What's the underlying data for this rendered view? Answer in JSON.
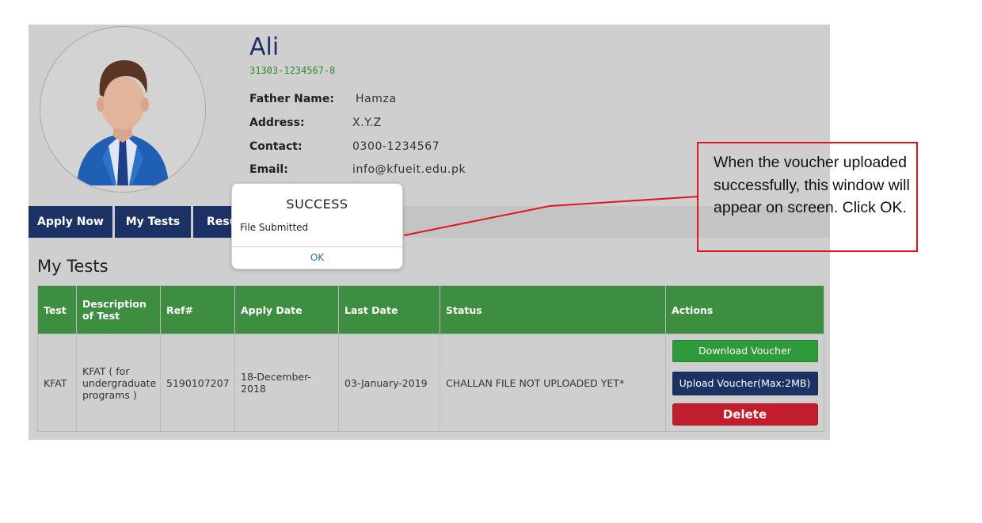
{
  "profile": {
    "name": "Ali",
    "id_number": "31303-1234567-8",
    "fields": [
      {
        "label": "Father Name:",
        "value": "Hamza"
      },
      {
        "label": "Address:",
        "value": "X.Y.Z"
      },
      {
        "label": "Contact:",
        "value": "0300-1234567"
      },
      {
        "label": "Email:",
        "value": "info@kfueit.edu.pk"
      }
    ]
  },
  "nav": {
    "tabs": [
      {
        "label": "Apply Now"
      },
      {
        "label": "My Tests"
      },
      {
        "label": "Resu"
      }
    ]
  },
  "tests": {
    "title": "My Tests",
    "columns": [
      "Test",
      "Description of Test",
      "Ref#",
      "Apply Date",
      "Last Date",
      "Status",
      "Actions"
    ],
    "rows": [
      {
        "test": "KFAT",
        "description": "KFAT ( for undergraduate programs )",
        "ref": "5190107207",
        "apply_date": "18-December-2018",
        "last_date": "03-January-2019",
        "status": "CHALLAN FILE NOT UPLOADED YET*",
        "actions": {
          "download": "Download Voucher",
          "upload": "Upload Voucher(Max:2MB)",
          "delete": "Delete"
        }
      }
    ]
  },
  "modal": {
    "title": "SUCCESS",
    "message": "File Submitted",
    "ok_label": "OK"
  },
  "callout": {
    "text": "When the voucher uploaded successfully, this window will appear on screen. Click OK.",
    "color": "#e3141c"
  },
  "colors": {
    "navy": "#1d3264",
    "green_header": "#3e8e41",
    "download_green": "#2f9a3a",
    "delete_red": "#c21d2c",
    "panel_gray": "#cfcfcf"
  }
}
